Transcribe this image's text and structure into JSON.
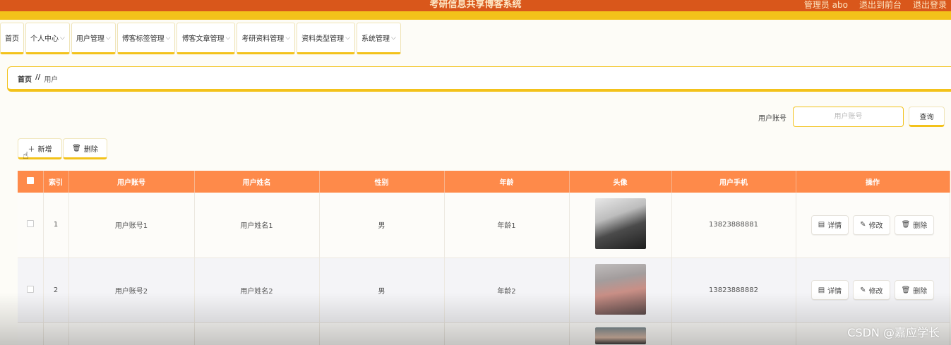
{
  "header": {
    "title": "考研信息共享博客系统",
    "admin_label": "管理员 abo",
    "to_front": "退出到前台",
    "logout": "退出登录"
  },
  "nav": {
    "items": [
      {
        "label": "首页",
        "has_menu": false
      },
      {
        "label": "个人中心",
        "has_menu": true
      },
      {
        "label": "用户管理",
        "has_menu": true
      },
      {
        "label": "博客标签管理",
        "has_menu": true
      },
      {
        "label": "博客文章管理",
        "has_menu": true
      },
      {
        "label": "考研资料管理",
        "has_menu": true
      },
      {
        "label": "资料类型管理",
        "has_menu": true
      },
      {
        "label": "系统管理",
        "has_menu": true
      }
    ]
  },
  "breadcrumb": {
    "home": "首页",
    "separator": "//",
    "current": "用户"
  },
  "search": {
    "label": "用户账号",
    "placeholder": "用户账号",
    "button": "查询"
  },
  "actions": {
    "add": "新增",
    "delete": "删除"
  },
  "table": {
    "headers": [
      "索引",
      "用户账号",
      "用户姓名",
      "性别",
      "年龄",
      "头像",
      "用户手机",
      "操作"
    ],
    "rows": [
      {
        "index": "1",
        "account": "用户账号1",
        "name": "用户姓名1",
        "gender": "男",
        "age": "年龄1",
        "phone": "13823888881"
      },
      {
        "index": "2",
        "account": "用户账号2",
        "name": "用户姓名2",
        "gender": "男",
        "age": "年龄2",
        "phone": "13823888882"
      }
    ],
    "row_actions": {
      "detail": "详情",
      "edit": "修改",
      "delete": "删除"
    }
  },
  "watermark": "CSDN @嘉应学长",
  "colors": {
    "accent_orange": "#d9571b",
    "accent_yellow": "#f3c21a",
    "table_header": "#fe8a4a"
  }
}
